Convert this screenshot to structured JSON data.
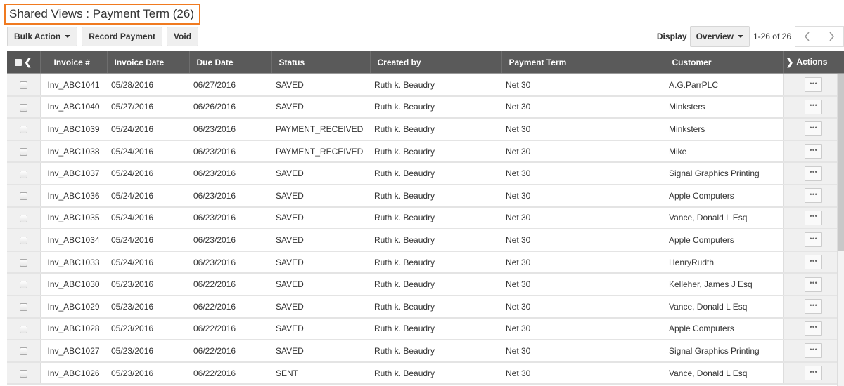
{
  "header": {
    "title": "Shared Views : Payment Term (26)",
    "accent_color": "#f07a20"
  },
  "toolbar": {
    "bulk_action_label": "Bulk Action",
    "record_payment_label": "Record Payment",
    "void_label": "Void",
    "display_label": "Display",
    "display_value": "Overview",
    "page_range": "1-26 of 26",
    "prev_icon": "chevron-left-icon",
    "next_icon": "chevron-right-icon"
  },
  "table": {
    "columns": {
      "select": "",
      "invoice_no": "Invoice #",
      "invoice_date": "Invoice Date",
      "due_date": "Due Date",
      "status": "Status",
      "created_by": "Created by",
      "payment_term": "Payment Term",
      "customer": "Customer",
      "actions": "Actions"
    },
    "action_button_label": "•••",
    "rows": [
      {
        "invoice_no": "Inv_ABC1041",
        "invoice_date": "05/28/2016",
        "due_date": "06/27/2016",
        "status": "SAVED",
        "created_by": "Ruth k. Beaudry",
        "payment_term": "Net 30",
        "customer": "A.G.ParrPLC"
      },
      {
        "invoice_no": "Inv_ABC1040",
        "invoice_date": "05/27/2016",
        "due_date": "06/26/2016",
        "status": "SAVED",
        "created_by": "Ruth k. Beaudry",
        "payment_term": "Net 30",
        "customer": "Minksters"
      },
      {
        "invoice_no": "Inv_ABC1039",
        "invoice_date": "05/24/2016",
        "due_date": "06/23/2016",
        "status": "PAYMENT_RECEIVED",
        "created_by": "Ruth k. Beaudry",
        "payment_term": "Net 30",
        "customer": "Minksters"
      },
      {
        "invoice_no": "Inv_ABC1038",
        "invoice_date": "05/24/2016",
        "due_date": "06/23/2016",
        "status": "PAYMENT_RECEIVED",
        "created_by": "Ruth k. Beaudry",
        "payment_term": "Net 30",
        "customer": "Mike"
      },
      {
        "invoice_no": "Inv_ABC1037",
        "invoice_date": "05/24/2016",
        "due_date": "06/23/2016",
        "status": "SAVED",
        "created_by": "Ruth k. Beaudry",
        "payment_term": "Net 30",
        "customer": "Signal Graphics Printing"
      },
      {
        "invoice_no": "Inv_ABC1036",
        "invoice_date": "05/24/2016",
        "due_date": "06/23/2016",
        "status": "SAVED",
        "created_by": "Ruth k. Beaudry",
        "payment_term": "Net 30",
        "customer": "Apple Computers"
      },
      {
        "invoice_no": "Inv_ABC1035",
        "invoice_date": "05/24/2016",
        "due_date": "06/23/2016",
        "status": "SAVED",
        "created_by": "Ruth k. Beaudry",
        "payment_term": "Net 30",
        "customer": "Vance, Donald L Esq"
      },
      {
        "invoice_no": "Inv_ABC1034",
        "invoice_date": "05/24/2016",
        "due_date": "06/23/2016",
        "status": "SAVED",
        "created_by": "Ruth k. Beaudry",
        "payment_term": "Net 30",
        "customer": "Apple Computers"
      },
      {
        "invoice_no": "Inv_ABC1033",
        "invoice_date": "05/24/2016",
        "due_date": "06/23/2016",
        "status": "SAVED",
        "created_by": "Ruth k. Beaudry",
        "payment_term": "Net 30",
        "customer": "HenryRudth"
      },
      {
        "invoice_no": "Inv_ABC1030",
        "invoice_date": "05/23/2016",
        "due_date": "06/22/2016",
        "status": "SAVED",
        "created_by": "Ruth k. Beaudry",
        "payment_term": "Net 30",
        "customer": "Kelleher, James J Esq"
      },
      {
        "invoice_no": "Inv_ABC1029",
        "invoice_date": "05/23/2016",
        "due_date": "06/22/2016",
        "status": "SAVED",
        "created_by": "Ruth k. Beaudry",
        "payment_term": "Net 30",
        "customer": "Vance, Donald L Esq"
      },
      {
        "invoice_no": "Inv_ABC1028",
        "invoice_date": "05/23/2016",
        "due_date": "06/22/2016",
        "status": "SAVED",
        "created_by": "Ruth k. Beaudry",
        "payment_term": "Net 30",
        "customer": "Apple Computers"
      },
      {
        "invoice_no": "Inv_ABC1027",
        "invoice_date": "05/23/2016",
        "due_date": "06/22/2016",
        "status": "SAVED",
        "created_by": "Ruth k. Beaudry",
        "payment_term": "Net 30",
        "customer": "Signal Graphics Printing"
      },
      {
        "invoice_no": "Inv_ABC1026",
        "invoice_date": "05/23/2016",
        "due_date": "06/22/2016",
        "status": "SENT",
        "created_by": "Ruth k. Beaudry",
        "payment_term": "Net 30",
        "customer": "Vance, Donald L Esq"
      }
    ]
  }
}
